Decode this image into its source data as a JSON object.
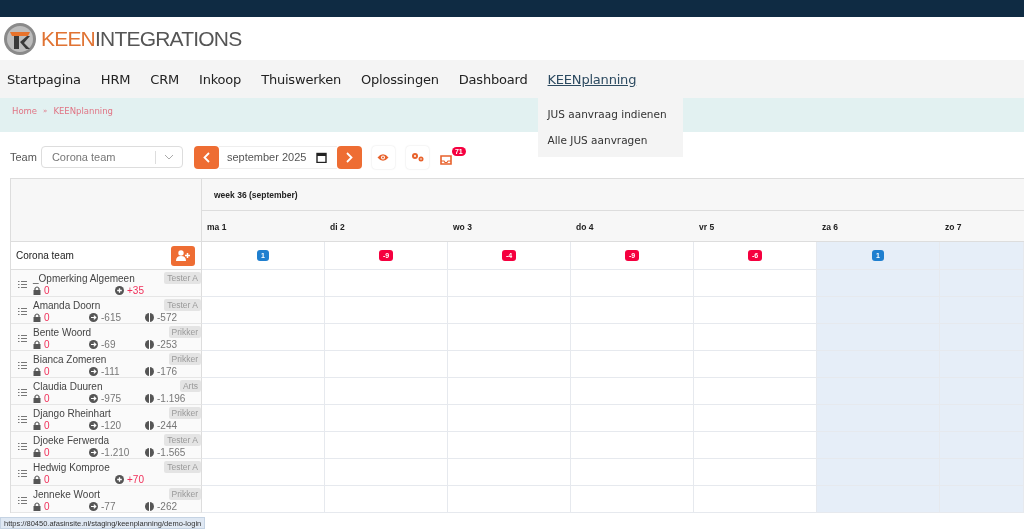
{
  "header": {
    "logo": {
      "part_1": "KEEN",
      "part_2": "INTEGRATIONS"
    }
  },
  "nav": {
    "items": [
      {
        "label": "Startpagina",
        "selected": false
      },
      {
        "label": "HRM",
        "selected": false
      },
      {
        "label": "CRM",
        "selected": false
      },
      {
        "label": "Inkoop",
        "selected": false
      },
      {
        "label": "Thuiswerken",
        "selected": false
      },
      {
        "label": "Oplossingen",
        "selected": false
      },
      {
        "label": "Dashboard",
        "selected": false
      },
      {
        "label": "KEENplanning",
        "selected": true
      }
    ],
    "dropdown": [
      "JUS aanvraag indienen",
      "Alle JUS aanvragen"
    ]
  },
  "breadcrumb": [
    "Home",
    "»",
    "KEENplanning"
  ],
  "toolbar": {
    "team_label": "Team",
    "team_value": "Corona team",
    "date_value": "september 2025",
    "inbox_count": "71"
  },
  "planner": {
    "week_label": "week 36 (september)",
    "team_name": "Corona team",
    "days": [
      {
        "label": "ma 1",
        "weekend": false,
        "badge": "1",
        "color": "#1f7fcf"
      },
      {
        "label": "di 2",
        "weekend": false,
        "badge": "-9",
        "color": "#f5003f"
      },
      {
        "label": "wo 3",
        "weekend": false,
        "badge": "-4",
        "color": "#f5003f"
      },
      {
        "label": "do 4",
        "weekend": false,
        "badge": "-9",
        "color": "#f5003f"
      },
      {
        "label": "vr 5",
        "weekend": false,
        "badge": "-6",
        "color": "#f5003f"
      },
      {
        "label": "za 6",
        "weekend": true,
        "badge": "1",
        "color": "#1f7fcf"
      },
      {
        "label": "zo 7",
        "weekend": true
      }
    ],
    "rows": [
      {
        "name": "_Opmerking Algemeen",
        "role": "Tester A",
        "locked": "0",
        "balances": [
          {
            "kind": "plus",
            "value": "+35"
          }
        ]
      },
      {
        "name": "Amanda Doorn",
        "role": "Tester A",
        "locked": "0",
        "balances": [
          {
            "kind": "arrow",
            "value": "-615"
          },
          {
            "kind": "clock",
            "value": "-572"
          }
        ]
      },
      {
        "name": "Bente Woord",
        "role": "Prikker",
        "locked": "0",
        "balances": [
          {
            "kind": "arrow",
            "value": "-69"
          },
          {
            "kind": "clock",
            "value": "-253"
          }
        ]
      },
      {
        "name": "Bianca Zomeren",
        "role": "Prikker",
        "locked": "0",
        "balances": [
          {
            "kind": "arrow",
            "value": "-111"
          },
          {
            "kind": "clock",
            "value": "-176"
          }
        ]
      },
      {
        "name": "Claudia Duuren",
        "role": "Arts",
        "locked": "0",
        "balances": [
          {
            "kind": "arrow",
            "value": "-975"
          },
          {
            "kind": "clock",
            "value": "-1.196"
          }
        ]
      },
      {
        "name": "Django Rheinhart",
        "role": "Prikker",
        "locked": "0",
        "balances": [
          {
            "kind": "arrow",
            "value": "-120"
          },
          {
            "kind": "clock",
            "value": "-244"
          }
        ]
      },
      {
        "name": "Djoeke Ferwerda",
        "role": "Tester A",
        "locked": "0",
        "balances": [
          {
            "kind": "arrow",
            "value": "-1.210"
          },
          {
            "kind": "clock",
            "value": "-1.565"
          }
        ]
      },
      {
        "name": "Hedwig Komproe",
        "role": "Tester A",
        "locked": "0",
        "balances": [
          {
            "kind": "plus",
            "value": "+70"
          }
        ]
      },
      {
        "name": "Jenneke Woort",
        "role": "Prikker",
        "locked": "0",
        "balances": [
          {
            "kind": "arrow",
            "value": "-77"
          },
          {
            "kind": "clock",
            "value": "-262"
          }
        ]
      }
    ]
  },
  "status_bar": {
    "url": "https://80450.afasinsite.nl/staging/keenplanning/demo-login"
  }
}
